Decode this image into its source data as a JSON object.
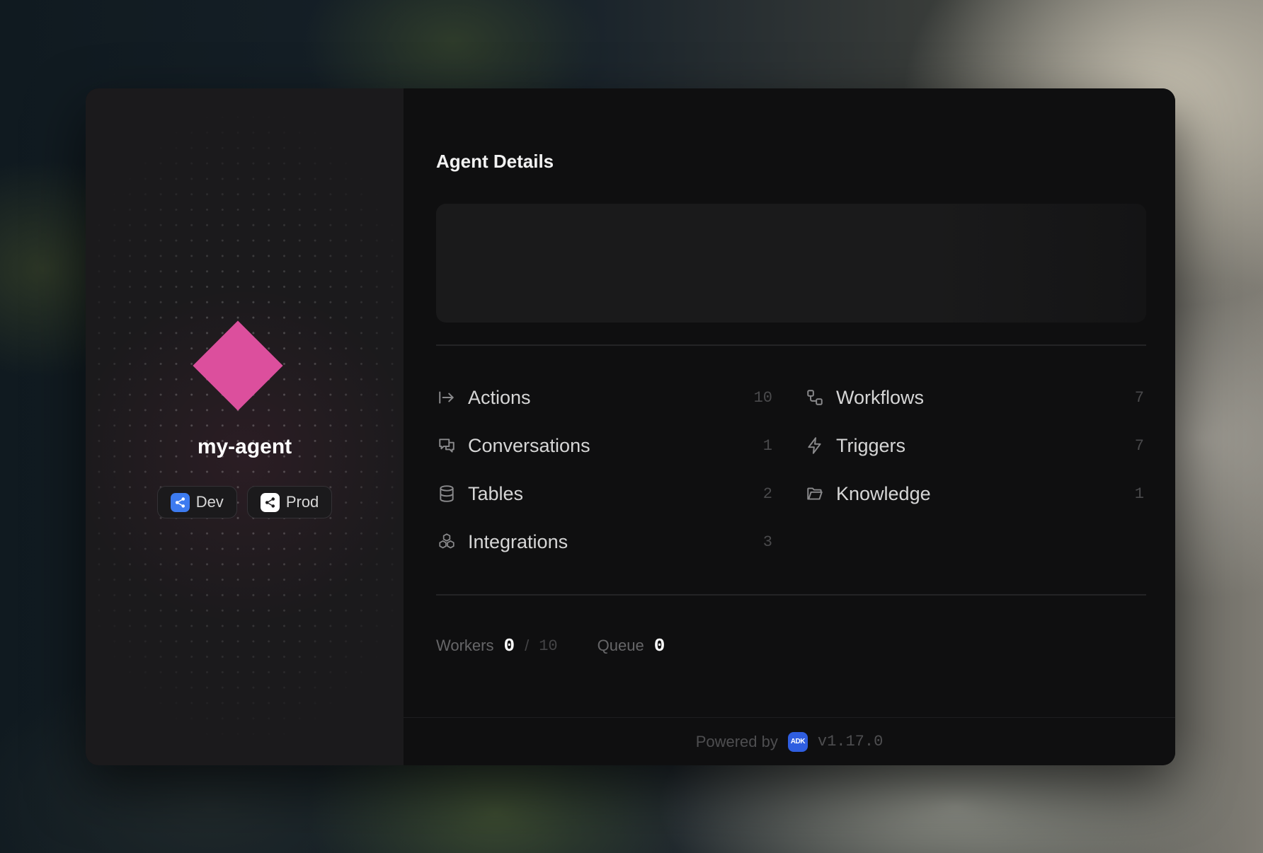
{
  "agent": {
    "name": "my-agent",
    "accent_color": "#dc4f9d",
    "logo_icon": "diamond-icon"
  },
  "environments": [
    {
      "label": "Dev",
      "icon": "share-icon",
      "color": "#3d7bf0"
    },
    {
      "label": "Prod",
      "icon": "share-icon",
      "color": "#ffffff"
    }
  ],
  "details": {
    "title": "Agent Details"
  },
  "stats": {
    "actions": {
      "label": "Actions",
      "count": "10",
      "icon": "arrow-right-bar-icon"
    },
    "conversations": {
      "label": "Conversations",
      "count": "1",
      "icon": "chat-bubbles-icon"
    },
    "tables": {
      "label": "Tables",
      "count": "2",
      "icon": "database-icon"
    },
    "integrations": {
      "label": "Integrations",
      "count": "3",
      "icon": "boxes-icon"
    },
    "workflows": {
      "label": "Workflows",
      "count": "7",
      "icon": "workflow-icon"
    },
    "triggers": {
      "label": "Triggers",
      "count": "7",
      "icon": "lightning-icon"
    },
    "knowledge": {
      "label": "Knowledge",
      "count": "1",
      "icon": "folder-icon"
    }
  },
  "load": {
    "workers_label": "Workers",
    "workers_value": "0",
    "workers_sep": "/",
    "workers_max": "10",
    "queue_label": "Queue",
    "queue_value": "0"
  },
  "footer": {
    "powered_by": "Powered by",
    "badge": "ADK",
    "badge_color": "#2f5ee0",
    "version": "v1.17.0"
  }
}
